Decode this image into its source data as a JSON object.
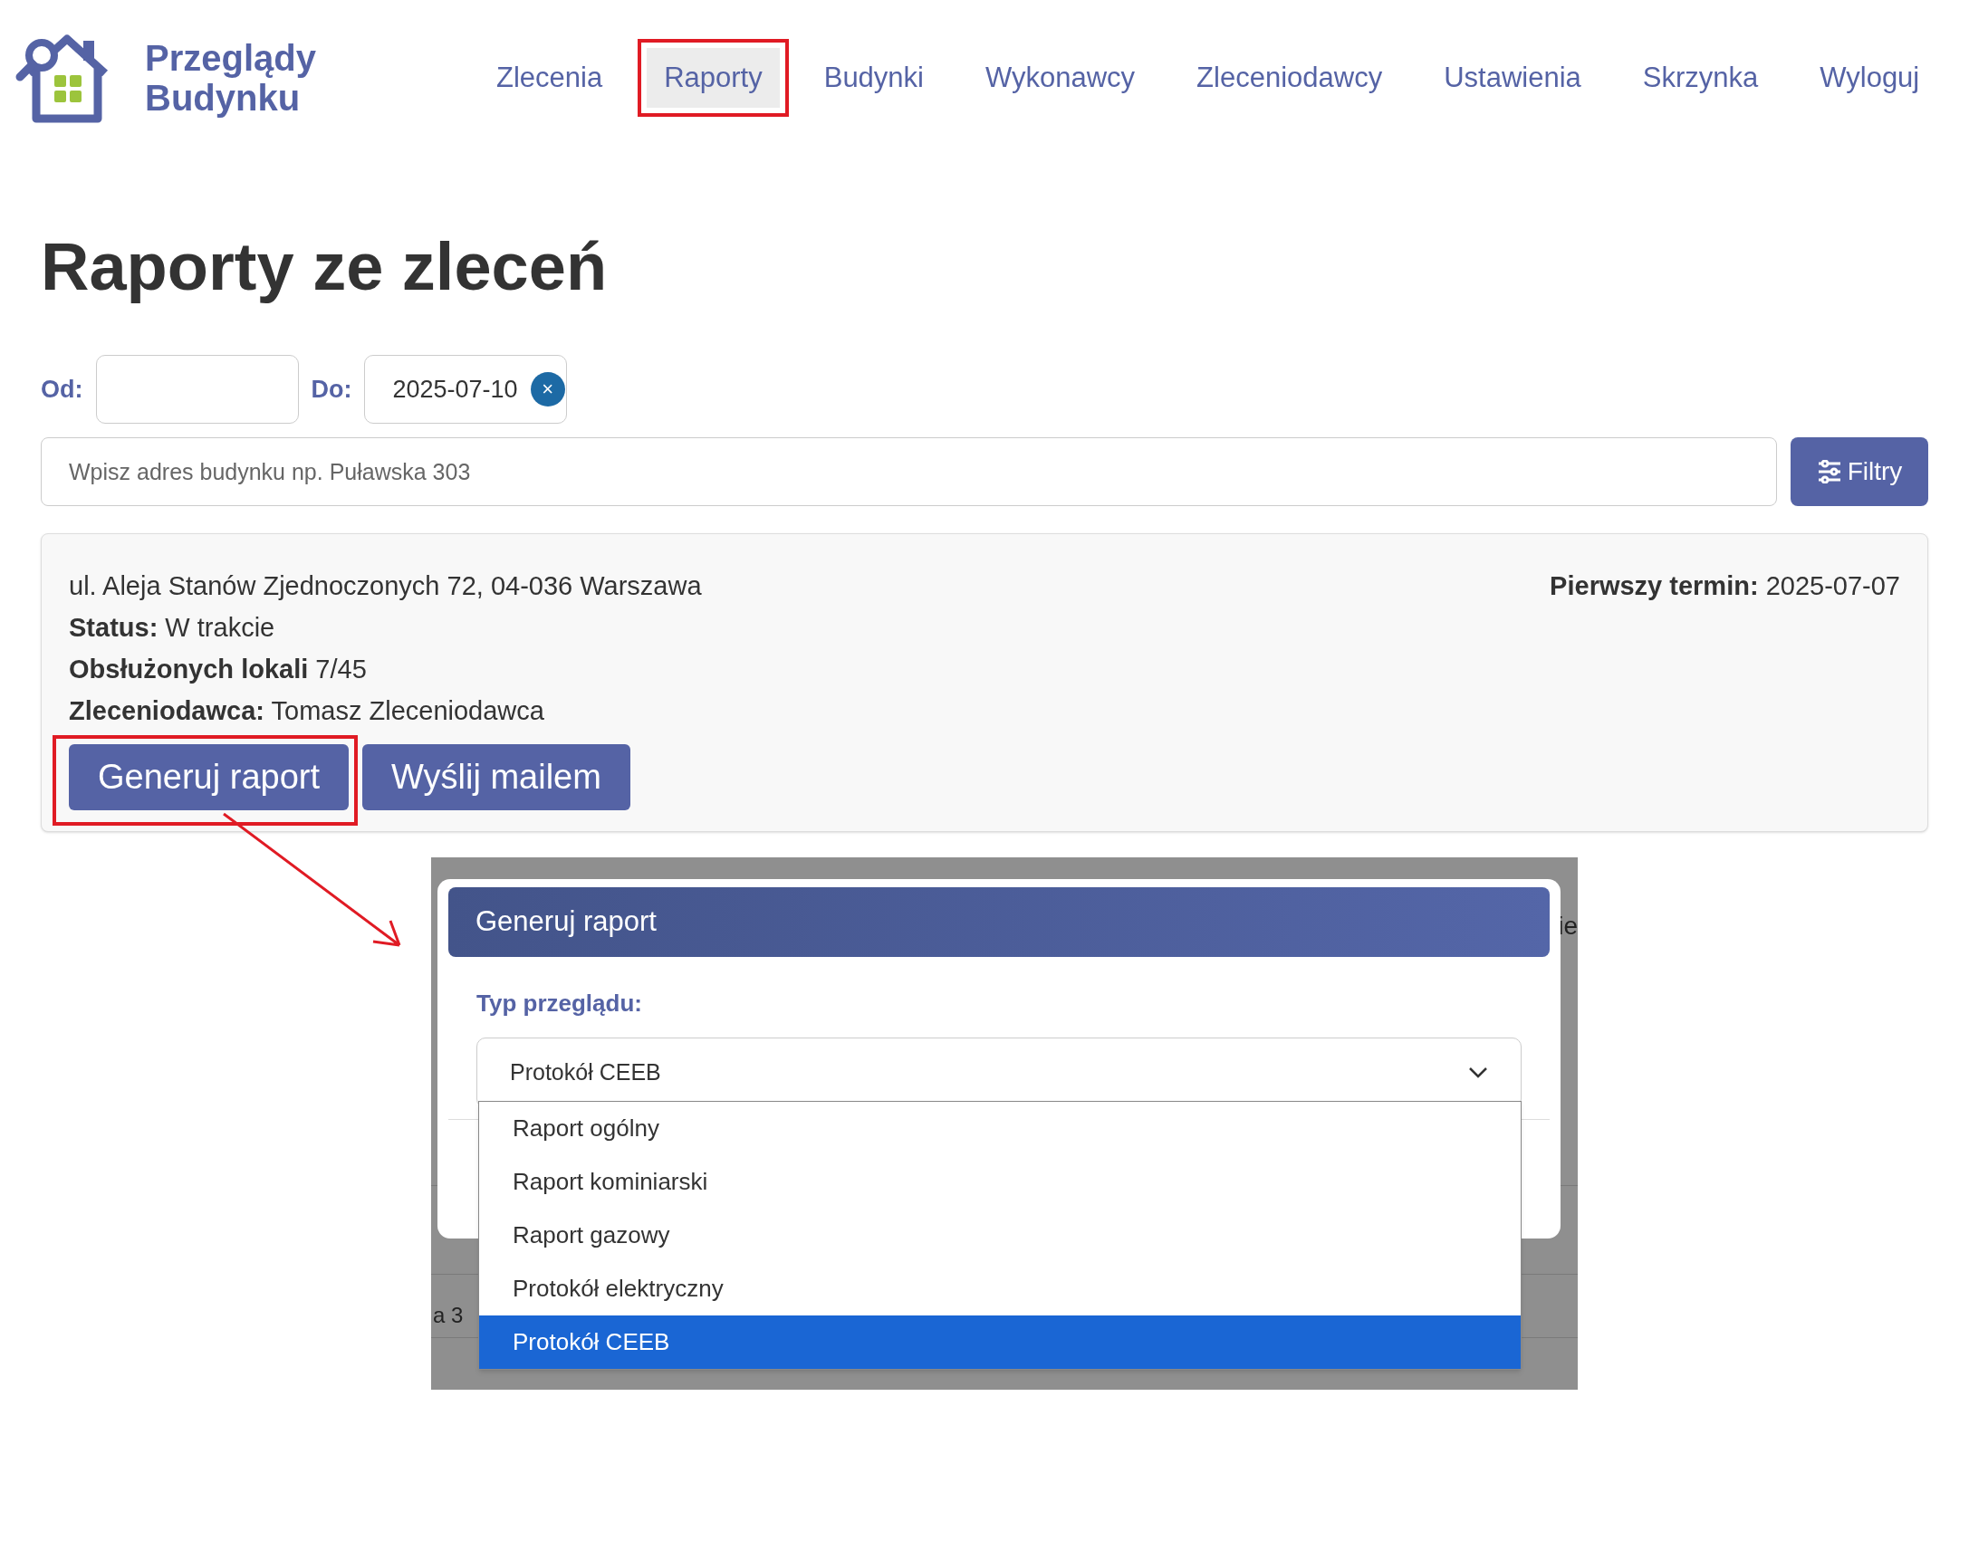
{
  "brand": {
    "line1": "Przeglądy",
    "line2": "Budynku"
  },
  "nav": [
    {
      "label": "Zlecenia",
      "selected": false
    },
    {
      "label": "Raporty",
      "selected": true
    },
    {
      "label": "Budynki",
      "selected": false
    },
    {
      "label": "Wykonawcy",
      "selected": false
    },
    {
      "label": "Zleceniodawcy",
      "selected": false
    },
    {
      "label": "Ustawienia",
      "selected": false
    },
    {
      "label": "Skrzynka",
      "selected": false
    },
    {
      "label": "Wyloguj",
      "selected": false
    }
  ],
  "title": "Raporty ze zleceń",
  "date_filter": {
    "from_label": "Od:",
    "to_label": "Do:",
    "to_value": "2025-07-10",
    "clear": "×"
  },
  "search": {
    "placeholder": "Wpisz adres budynku np. Puławska 303"
  },
  "filters_button": "Filtry",
  "card": {
    "address": "ul. Aleja Stanów Zjednoczonych 72, 04-036 Warszawa",
    "first_term": {
      "label": "Pierwszy termin:",
      "value": "2025-07-07"
    },
    "fields": [
      {
        "label": "Status:",
        "value": "W trakcie"
      },
      {
        "label": "Obsłużonych lokali",
        "value": "7/45"
      },
      {
        "label": "Zleceniodawca:",
        "value": "Tomasz Zleceniodawca"
      }
    ],
    "buttons": [
      "Generuj raport",
      "Wyślij mailem"
    ]
  },
  "inset": {
    "background_fragments": [
      "ie",
      "a 3"
    ],
    "modal_title": "Generuj raport",
    "field_label": "Typ przeglądu:",
    "select_value": "Protokół CEEB",
    "options": [
      {
        "label": "Raport ogólny",
        "selected": false
      },
      {
        "label": "Raport kominiarski",
        "selected": false
      },
      {
        "label": "Raport gazowy",
        "selected": false
      },
      {
        "label": "Protokół elektryczny",
        "selected": false
      },
      {
        "label": "Protokół CEEB",
        "selected": true
      }
    ]
  }
}
